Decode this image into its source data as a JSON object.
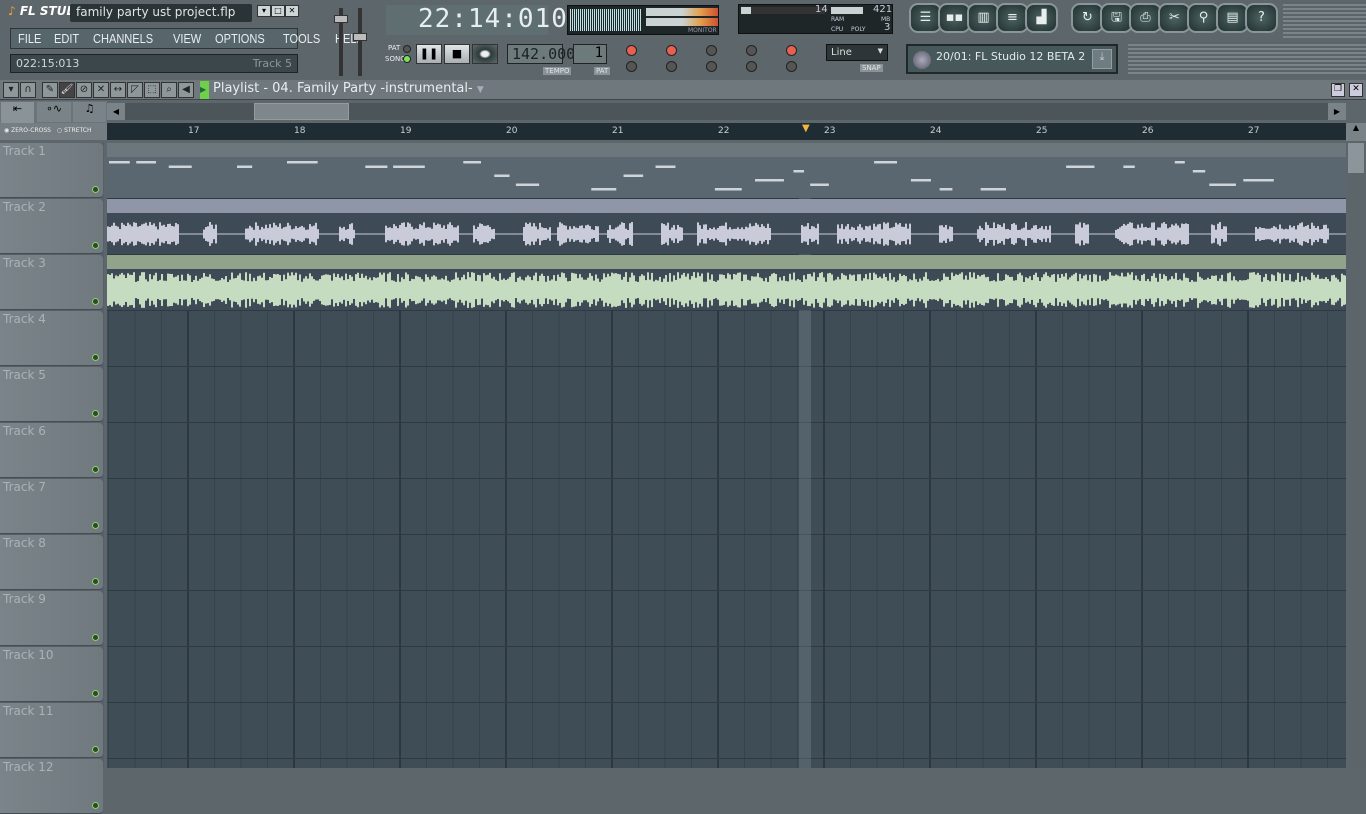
{
  "app": {
    "logo": "FL STUDIO",
    "project_file": "family party ust project.flp"
  },
  "menu": [
    "FILE",
    "EDIT",
    "CHANNELS",
    "VIEW",
    "OPTIONS",
    "TOOLS",
    "HELP"
  ],
  "hint": {
    "time": "022:15:013",
    "target": "Track 5"
  },
  "transport": {
    "clock": "22:14:010",
    "pat_label": "PAT",
    "song_label": "SONG",
    "tempo": "142.000",
    "tempo_label": "TEMPO",
    "pattern": "1",
    "pat_box_label": "PAT",
    "mode": "song"
  },
  "monitor": {
    "label": "MONITOR"
  },
  "cpu": {
    "value": "14",
    "ram_label": "RAM",
    "cpu_label": "CPU",
    "mb_label": "MB",
    "mb": "421",
    "poly_label": "POLY",
    "poly": "3"
  },
  "snap": {
    "value": "Line",
    "label": "SNAP"
  },
  "news": "20/01: FL Studio 12 BETA 2",
  "playlist": {
    "title": "Playlist - 04. Family Party -instrumental-",
    "zero_cross": "ZERO-CROSS",
    "stretch": "STRETCH",
    "bars": [
      "17",
      "18",
      "19",
      "20",
      "21",
      "22",
      "23",
      "24",
      "25",
      "26",
      "27"
    ],
    "tracks": [
      "Track 1",
      "Track 2",
      "Track 3",
      "Track 4",
      "Track 5",
      "Track 6",
      "Track 7",
      "Track 8",
      "Track 9",
      "Track 10",
      "Track 11",
      "Track 12"
    ]
  },
  "colors": {
    "clip_notes": "#5a6670",
    "clip_audio": "#8f96a8",
    "clip_audio2": "#8fa48a",
    "wave1": "#c9ccd8",
    "wave2": "#c6dcc0",
    "grid": "#3f4d57"
  }
}
